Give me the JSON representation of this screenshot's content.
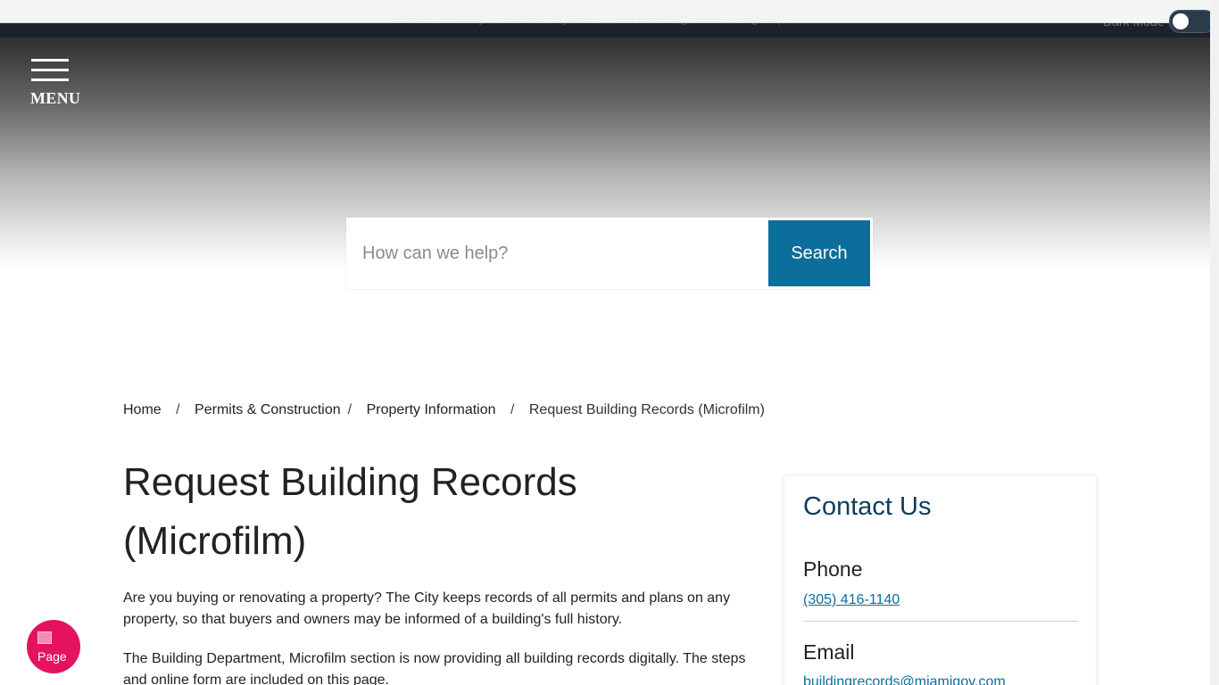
{
  "utility": {
    "links": [
      "Service Directory",
      "Make a Payment",
      "Get Breaking News",
      "Sign Up"
    ],
    "mode_label": "Dark Mode"
  },
  "menu": {
    "label": "MENU"
  },
  "search": {
    "placeholder": "How can we help?",
    "button_label": "Search"
  },
  "breadcrumb": {
    "items": [
      "Home",
      "Permits & Construction",
      "Property Information"
    ],
    "separator": "/",
    "current": "Request Building Records (Microfilm)"
  },
  "main": {
    "title": "Request Building Records (Microfilm)",
    "intro": "Are you buying or renovating a property? The City keeps records of all permits and plans on any property, so that buyers and owners may be informed of a building's full history.",
    "paragraph2": "The Building Department, Microfilm section is now providing all building records digitally. The steps and online form are included on this page."
  },
  "contact": {
    "title": "Contact Us",
    "phone_label": "Phone",
    "phone": "(305) 416-1140",
    "email_label": "Email",
    "email": "buildingrecords@miamigov.com"
  },
  "badge": {
    "text": "Page"
  },
  "colors": {
    "primary_blue": "#0c6e9b",
    "heading_navy": "#0b3d5c",
    "badge_pink": "#e5135f",
    "topbar_dark": "#1d2128"
  }
}
